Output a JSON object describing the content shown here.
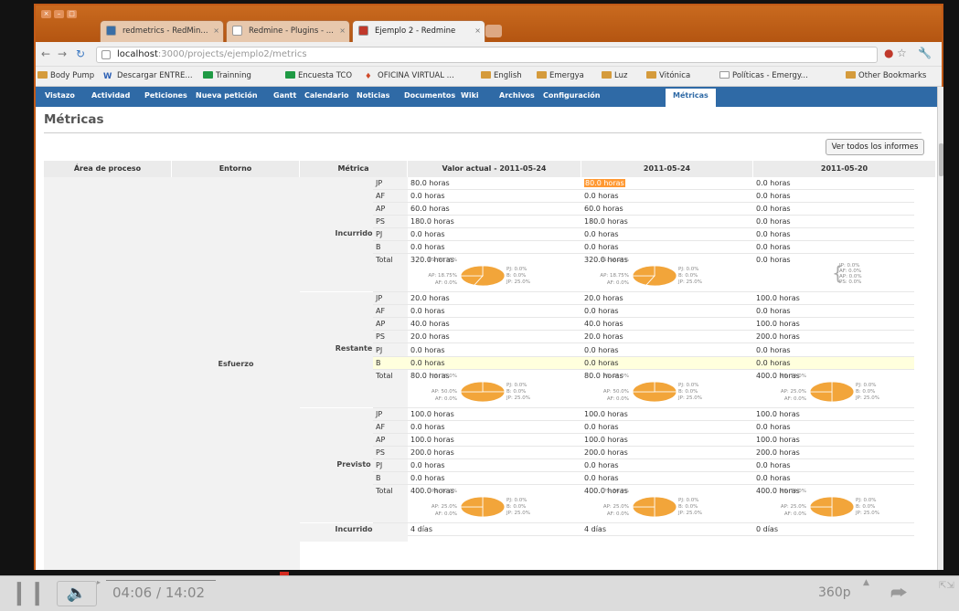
{
  "browser": {
    "tabs": [
      {
        "label": "redmetrics - RedMin...",
        "active": false,
        "icon_color": "#3a6ea5"
      },
      {
        "label": "Redmine - Plugins - ...",
        "active": false,
        "icon_color": "#ffffff"
      },
      {
        "label": "Ejemplo 2 - Redmine",
        "active": true,
        "icon_color": "#c0392b"
      }
    ],
    "url_host": "localhost",
    "url_rest": ":3000/projects/ejemplo2/metrics",
    "bookmarks": [
      "Body Pump",
      "Descargar ENTRE...",
      "Trainning",
      "Encuesta TCO",
      "OFICINA VIRTUAL ...",
      "English",
      "Emergya",
      "Luz",
      "Vitónica",
      "Políticas - Emergy..."
    ],
    "other_bookmarks": "Other Bookmarks"
  },
  "redmine": {
    "menu": [
      "Vistazo",
      "Actividad",
      "Peticiones",
      "Nueva petición",
      "Gantt",
      "Calendario",
      "Noticias",
      "Documentos",
      "Wiki",
      "Archivos",
      "Configuración",
      "Métricas"
    ],
    "selected_menu": "Métricas",
    "page_title": "Métricas",
    "ver_button": "Ver todos los informes",
    "table_headers": [
      "Área de proceso",
      "Entorno",
      "Métrica",
      "Valor actual - 2011-05-24",
      "2011-05-24",
      "2011-05-20"
    ],
    "area": "Esfuerzo",
    "groups": [
      {
        "name": "Incurrido",
        "rows": [
          {
            "label": "JP",
            "values": [
              "80.0 horas",
              "80.0 horas",
              "0.0 horas"
            ]
          },
          {
            "label": "AF",
            "values": [
              "0.0 horas",
              "0.0 horas",
              "0.0 horas"
            ]
          },
          {
            "label": "AP",
            "values": [
              "60.0 horas",
              "60.0 horas",
              "0.0 horas"
            ]
          },
          {
            "label": "PS",
            "values": [
              "180.0 horas",
              "180.0 horas",
              "0.0 horas"
            ]
          },
          {
            "label": "PJ",
            "values": [
              "0.0 horas",
              "0.0 horas",
              "0.0 horas"
            ]
          },
          {
            "label": "B",
            "values": [
              "0.0 horas",
              "0.0 horas",
              "0.0 horas"
            ]
          }
        ],
        "total": {
          "label": "Total",
          "values": [
            "320.0 horas",
            "320.0 horas",
            "0.0 horas"
          ]
        },
        "pies": [
          {
            "labels": [
              "PS: 56.25%",
              "AP: 18.75%",
              "AF: 0.0%",
              "PJ: 0.0%",
              "B: 0.0%",
              "JP: 25.0%"
            ],
            "slices": [
              56.25,
              18.75,
              0,
              0,
              0,
              25
            ]
          },
          {
            "labels": [
              "PS: 56.25%",
              "AP: 18.75%",
              "AF: 0.0%",
              "PJ: 0.0%",
              "B: 0.0%",
              "JP: 25.0%"
            ],
            "slices": [
              56.25,
              18.75,
              0,
              0,
              0,
              25
            ]
          },
          {
            "labels": [
              "JP: 0.0%",
              "AF: 0.0%",
              "AP: 0.0%",
              "PS: 0.0%"
            ],
            "slices": []
          }
        ]
      },
      {
        "name": "Restante",
        "rows": [
          {
            "label": "JP",
            "values": [
              "20.0 horas",
              "20.0 horas",
              "100.0 horas"
            ]
          },
          {
            "label": "AF",
            "values": [
              "0.0 horas",
              "0.0 horas",
              "0.0 horas"
            ]
          },
          {
            "label": "AP",
            "values": [
              "40.0 horas",
              "40.0 horas",
              "100.0 horas"
            ]
          },
          {
            "label": "PS",
            "values": [
              "20.0 horas",
              "20.0 horas",
              "200.0 horas"
            ]
          },
          {
            "label": "PJ",
            "values": [
              "0.0 horas",
              "0.0 horas",
              "0.0 horas"
            ]
          },
          {
            "label": "B",
            "values": [
              "0.0 horas",
              "0.0 horas",
              "0.0 horas"
            ]
          }
        ],
        "total": {
          "label": "Total",
          "values": [
            "80.0 horas",
            "80.0 horas",
            "400.0 horas"
          ]
        },
        "pies": [
          {
            "labels": [
              "PS: 25.0%",
              "AP: 50.0%",
              "AF: 0.0%",
              "PJ: 0.0%",
              "B: 0.0%",
              "JP: 25.0%"
            ],
            "slices": [
              25,
              50,
              0,
              0,
              0,
              25
            ]
          },
          {
            "labels": [
              "PS: 25.0%",
              "AP: 50.0%",
              "AF: 0.0%",
              "PJ: 0.0%",
              "B: 0.0%",
              "JP: 25.0%"
            ],
            "slices": [
              25,
              50,
              0,
              0,
              0,
              25
            ]
          },
          {
            "labels": [
              "PS: 50.0%",
              "AP: 25.0%",
              "AF: 0.0%",
              "PJ: 0.0%",
              "B: 0.0%",
              "JP: 25.0%"
            ],
            "slices": [
              50,
              25,
              0,
              0,
              0,
              25
            ]
          }
        ]
      },
      {
        "name": "Previsto",
        "rows": [
          {
            "label": "JP",
            "values": [
              "100.0 horas",
              "100.0 horas",
              "100.0 horas"
            ]
          },
          {
            "label": "AF",
            "values": [
              "0.0 horas",
              "0.0 horas",
              "0.0 horas"
            ]
          },
          {
            "label": "AP",
            "values": [
              "100.0 horas",
              "100.0 horas",
              "100.0 horas"
            ]
          },
          {
            "label": "PS",
            "values": [
              "200.0 horas",
              "200.0 horas",
              "200.0 horas"
            ]
          },
          {
            "label": "PJ",
            "values": [
              "0.0 horas",
              "0.0 horas",
              "0.0 horas"
            ]
          },
          {
            "label": "B",
            "values": [
              "0.0 horas",
              "0.0 horas",
              "0.0 horas"
            ]
          }
        ],
        "total": {
          "label": "Total",
          "values": [
            "400.0 horas",
            "400.0 horas",
            "400.0 horas"
          ]
        },
        "pies": [
          {
            "labels": [
              "PS: 50.0%",
              "AP: 25.0%",
              "AF: 0.0%",
              "PJ: 0.0%",
              "B: 0.0%",
              "JP: 25.0%"
            ],
            "slices": [
              50,
              25,
              0,
              0,
              0,
              25
            ]
          },
          {
            "labels": [
              "PS: 50.0%",
              "AP: 25.0%",
              "AF: 0.0%",
              "PJ: 0.0%",
              "B: 0.0%",
              "JP: 25.0%"
            ],
            "slices": [
              50,
              25,
              0,
              0,
              0,
              25
            ]
          },
          {
            "labels": [
              "PS: 50.0%",
              "AP: 25.0%",
              "AF: 0.0%",
              "PJ: 0.0%",
              "B: 0.0%",
              "JP: 25.0%"
            ],
            "slices": [
              50,
              25,
              0,
              0,
              0,
              25
            ]
          }
        ]
      }
    ],
    "next_group": {
      "name": "Incurrido",
      "values": [
        "4 días",
        "4 días",
        "0 días"
      ]
    },
    "highlight_cell": "80.0 horas",
    "colors": {
      "menu": "#2f6aa6",
      "pie": "#f2a53a",
      "highlight": "#ff9933",
      "row_highlight": "#ffffdd"
    }
  },
  "player": {
    "current_time": "04:06",
    "duration": "14:02",
    "time_sep": " / ",
    "quality": "360p",
    "progress": 0.292
  }
}
